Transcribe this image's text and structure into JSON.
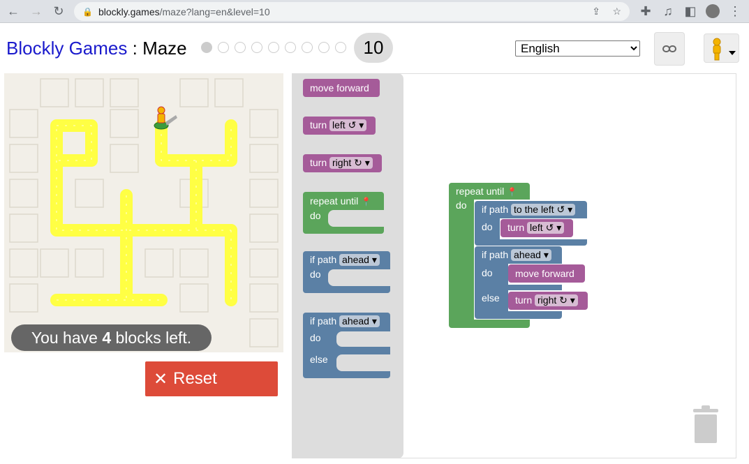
{
  "browser": {
    "url_host": "blockly.games",
    "url_path": "/maze?lang=en&level=10"
  },
  "header": {
    "brand": "Blockly Games",
    "separator": " : ",
    "app": "Maze",
    "level": "10",
    "levels_total": 10,
    "levels_completed": 0,
    "language": "English",
    "language_options": [
      "English"
    ]
  },
  "maze": {
    "message_prefix": "You have ",
    "blocks_left": "4",
    "message_suffix": " blocks left.",
    "reset_label": "Reset"
  },
  "toolbox": {
    "move_forward": "move forward",
    "turn": "turn",
    "left": "left ↺",
    "right": "right ↻",
    "repeat_until": "repeat until",
    "do": "do",
    "if_path": "if path",
    "ahead": "ahead",
    "else": "else"
  },
  "program": {
    "repeat_until": "repeat until",
    "do": "do",
    "if1_label": "if path",
    "if1_dir": "to the left ↺",
    "if1_do": "do",
    "if1_turn": "turn",
    "if1_turn_dir": "left ↺",
    "if2_label": "if path",
    "if2_dir": "ahead",
    "if2_do": "do",
    "if2_move": "move forward",
    "if2_else": "else",
    "if2_turn": "turn",
    "if2_turn_dir": "right ↻"
  },
  "colors": {
    "motion": "#a55b99",
    "loop": "#5ba55b",
    "logic": "#5b80a5",
    "path": "#ffff44",
    "reset": "#dd4b39"
  }
}
